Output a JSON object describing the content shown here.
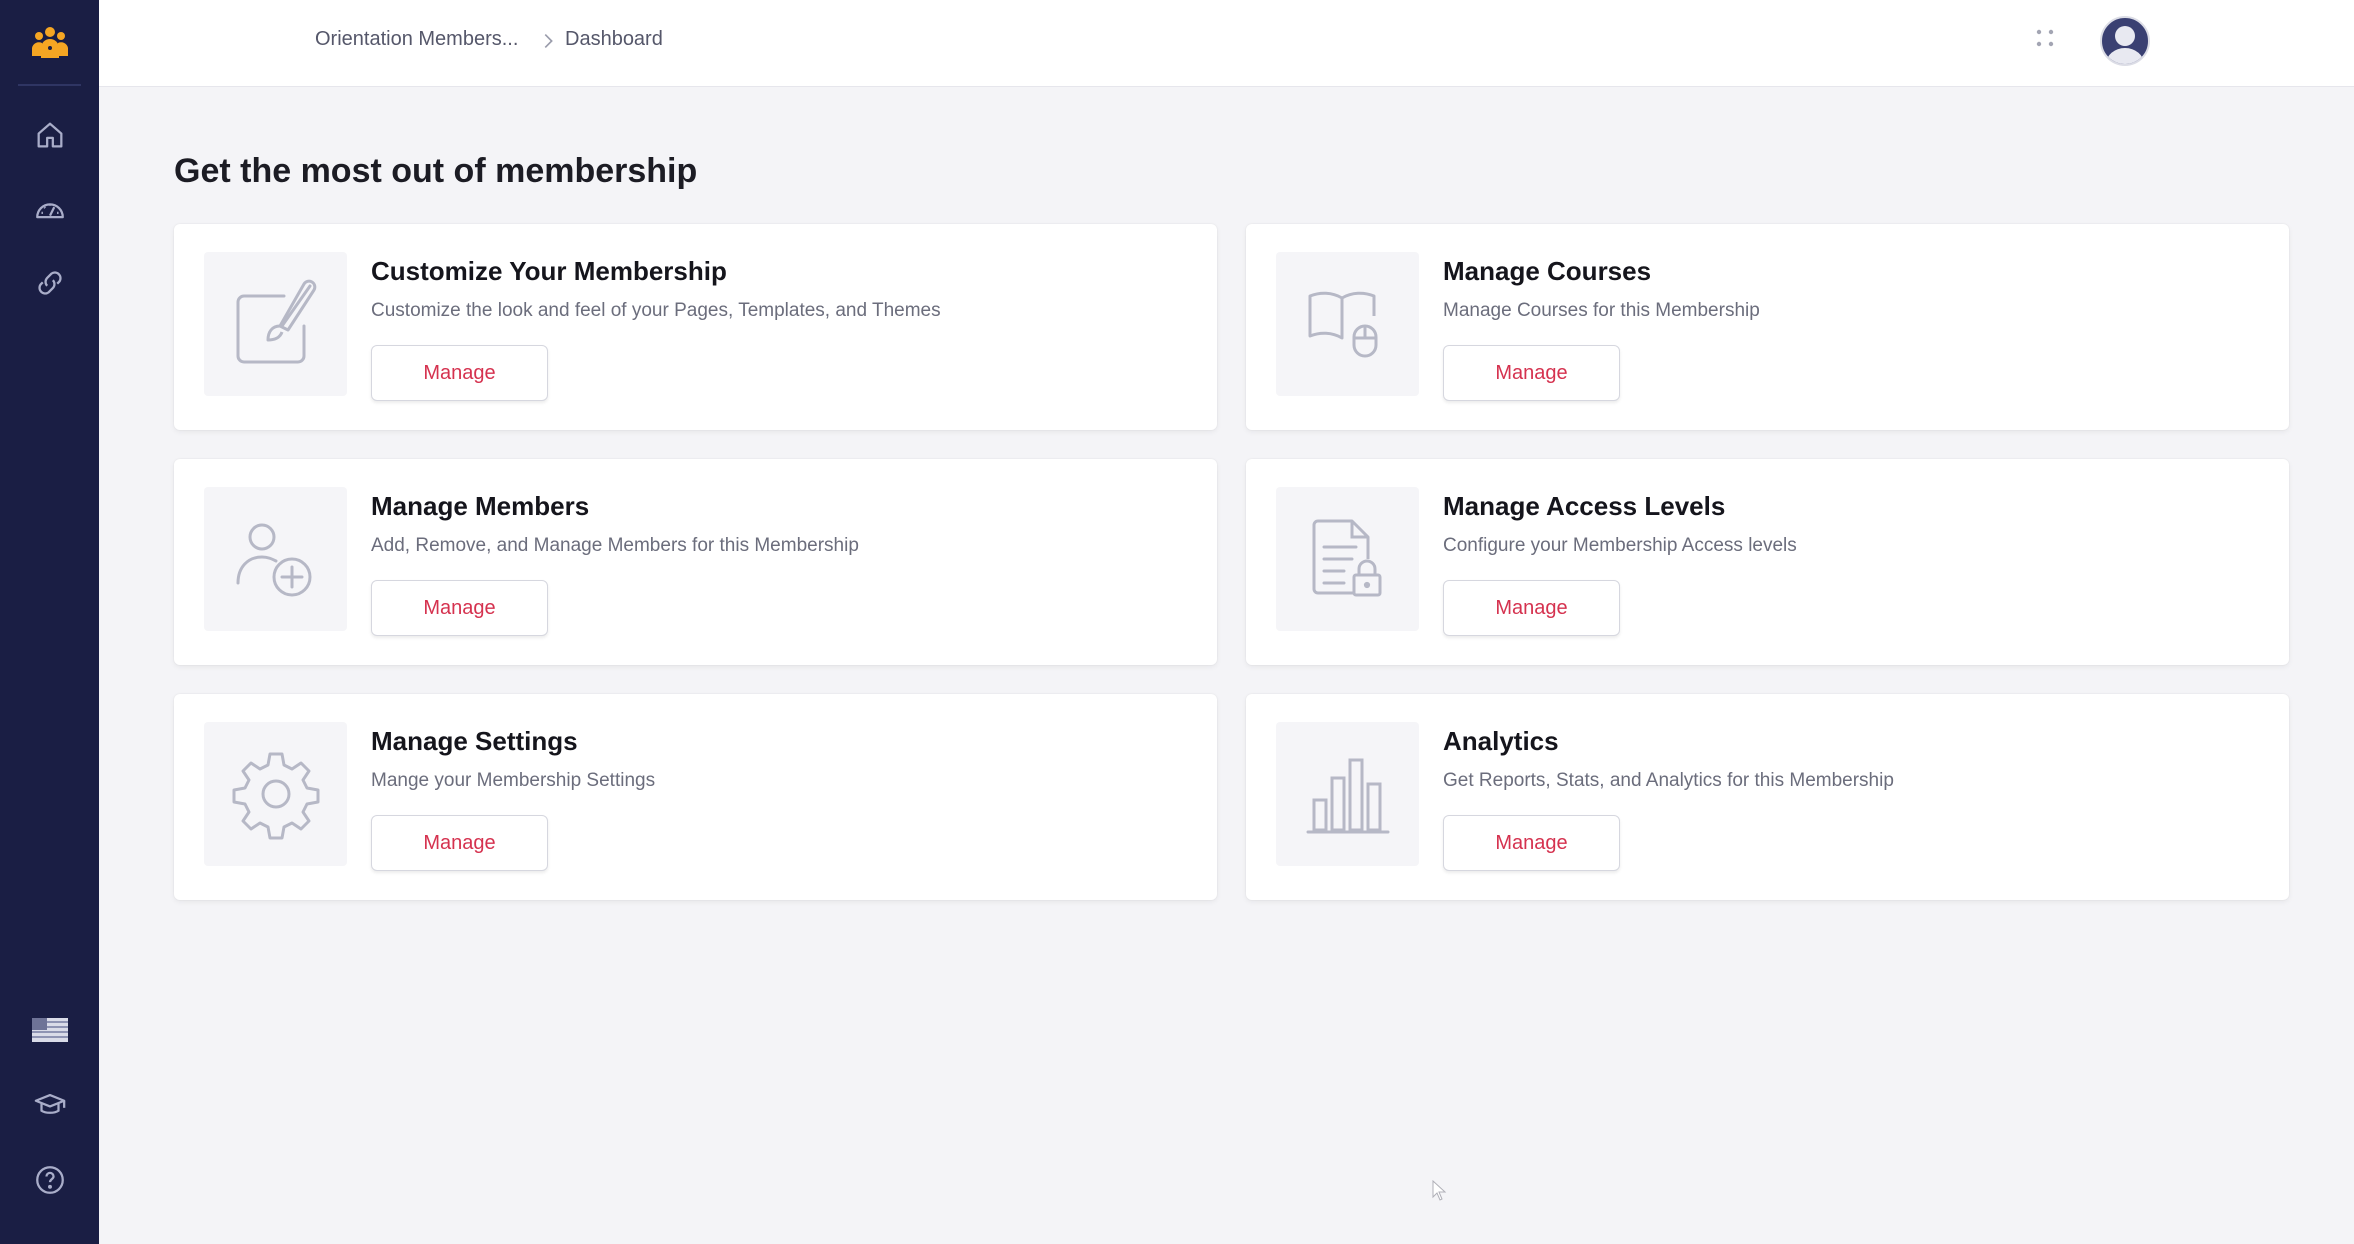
{
  "breadcrumb": {
    "parent": "Orientation Members...",
    "current": "Dashboard"
  },
  "sidebar": {
    "top_items": [
      {
        "icon": "home-icon"
      },
      {
        "icon": "dashboard-gauge-icon"
      },
      {
        "icon": "link-icon"
      }
    ],
    "bottom_items": [
      {
        "icon": "us-flag-icon"
      },
      {
        "icon": "graduation-cap-icon"
      },
      {
        "icon": "help-icon"
      }
    ]
  },
  "main": {
    "title": "Get the most out of membership",
    "cards": [
      {
        "title": "Customize Your Membership",
        "description": "Customize the look and feel of your Pages, Templates, and Themes",
        "button": "Manage",
        "icon": "edit-brush-icon"
      },
      {
        "title": "Manage Courses",
        "description": "Manage Courses for this Membership",
        "button": "Manage",
        "icon": "book-mouse-icon"
      },
      {
        "title": "Manage Members",
        "description": "Add, Remove, and Manage Members for this Membership",
        "button": "Manage",
        "icon": "user-add-icon"
      },
      {
        "title": "Manage Access Levels",
        "description": "Configure your Membership Access levels",
        "button": "Manage",
        "icon": "document-lock-icon"
      },
      {
        "title": "Manage Settings",
        "description": "Mange your Membership Settings",
        "button": "Manage",
        "icon": "gear-icon"
      },
      {
        "title": "Analytics",
        "description": "Get Reports, Stats, and Analytics for this Membership",
        "button": "Manage",
        "icon": "bar-chart-icon"
      }
    ]
  },
  "colors": {
    "sidebar_bg": "#1a1e44",
    "accent_text": "#d5324f",
    "logo": "#f5a623"
  }
}
